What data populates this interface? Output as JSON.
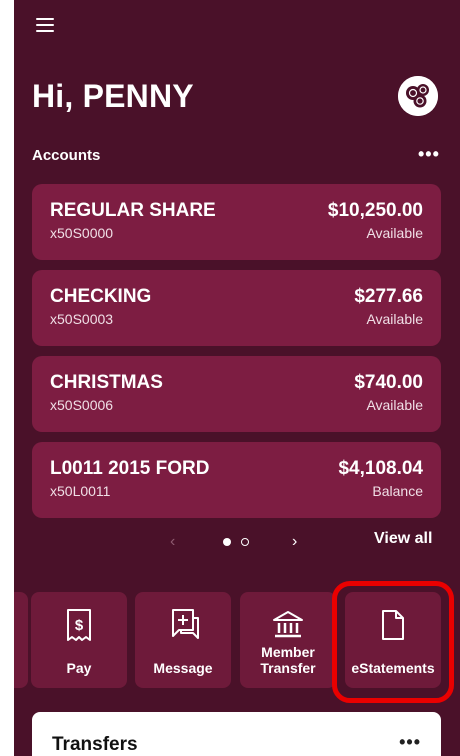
{
  "header": {
    "greeting": "Hi, PENNY",
    "menu_icon": "hamburger-menu-icon",
    "avatar_icon": "profile-avatar-icon"
  },
  "accounts": {
    "section_label": "Accounts",
    "more_label": "•••",
    "items": [
      {
        "name": "REGULAR SHARE",
        "number": "x50S0000",
        "amount": "$10,250.00",
        "status": "Available"
      },
      {
        "name": "CHECKING",
        "number": "x50S0003",
        "amount": "$277.66",
        "status": "Available"
      },
      {
        "name": "CHRISTMAS",
        "number": "x50S0006",
        "amount": "$740.00",
        "status": "Available"
      },
      {
        "name": "L0011 2015 FORD",
        "number": "x50L0011",
        "amount": "$4,108.04",
        "status": "Balance"
      }
    ]
  },
  "pager": {
    "prev": "‹",
    "next": "›",
    "view_all": "View all",
    "current_page": 1,
    "total_pages": 2
  },
  "quick_actions": [
    {
      "label": "Pay",
      "icon": "bill-pay-icon"
    },
    {
      "label": "Message",
      "icon": "message-icon"
    },
    {
      "label": "Member Transfer",
      "icon": "bank-icon"
    },
    {
      "label": "eStatements",
      "icon": "document-icon"
    }
  ],
  "transfers": {
    "title": "Transfers",
    "more_label": "•••"
  },
  "colors": {
    "background": "#4a1129",
    "card": "#7d1d42",
    "tile": "#6e1a3a",
    "highlight": "#ea0000"
  }
}
